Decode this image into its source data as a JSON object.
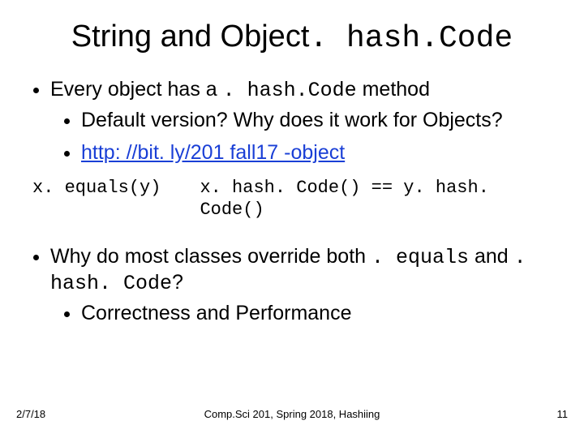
{
  "title_parts": {
    "pre": "String and Object",
    "code": ". hash.Code"
  },
  "bullets": {
    "b1_pre": "Every object has a ",
    "b1_code": ". hash.Code",
    "b1_post": " method",
    "b1a": "Default version? Why does it work for Objects?",
    "b1b_link": "http: //bit. ly/201 fall17 -object",
    "eq_left": "x. equals(y)",
    "eq_right": "x. hash. Code() == y. hash. Code()",
    "b2_pre": "Why do most classes override both ",
    "b2_code1": ". equals",
    "b2_mid": " and ",
    "b2_code2": ". hash. Code",
    "b2_post": "?",
    "b2a": "Correctness and Performance"
  },
  "footer": {
    "date": "2/7/18",
    "center": "Comp.Sci 201, Spring 2018,  Hashiing",
    "page": "11"
  }
}
